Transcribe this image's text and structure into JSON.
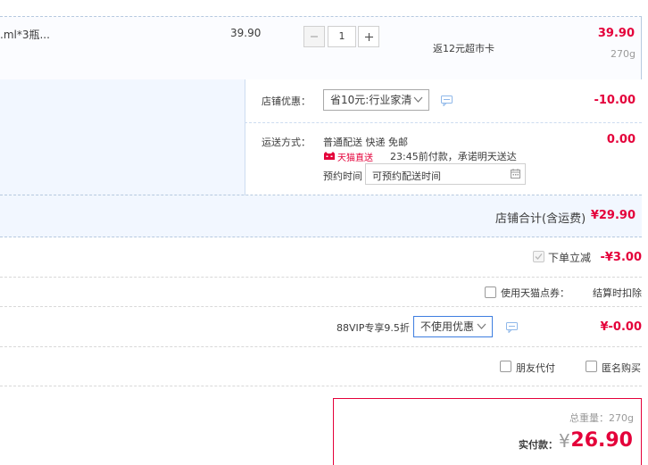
{
  "product": {
    "name_fragment": ".ml*3瓶...",
    "unit_price": "39.90",
    "quantity": "1",
    "minus_label": "−",
    "plus_label": "+",
    "promo": "返12元超市卡",
    "total": "39.90",
    "weight": "270g"
  },
  "shop": {
    "discount_label": "店铺优惠：",
    "discount_select": "省10元:行业家清",
    "discount_amount": "-10.00",
    "shipping_label": "运送方式：",
    "shipping_method": "普通配送 快递 免邮",
    "tmall_badge": "天猫直送",
    "delivery_note": "23:45前付款，承诺明天送达",
    "reserve_label": "预约时间",
    "reserve_placeholder": "可预约配送时间",
    "shipping_amount": "0.00",
    "subtotal_label": "店铺合计(含运费)",
    "subtotal_amount": "¥29.90"
  },
  "order": {
    "instant_label": "下单立减",
    "instant_amount": "-¥3.00",
    "points_label": "使用天猫点券：",
    "points_note": "结算时扣除",
    "vip_label": "88VIP专享9.5折",
    "vip_select": "不使用优惠",
    "vip_amount": "¥-0.00",
    "friend_pay_label": "朋友代付",
    "anonymous_label": "匿名购买"
  },
  "summary": {
    "weight_label": "总重量：270g",
    "paid_label": "实付款：",
    "currency": "¥",
    "paid_amount": "26.90"
  },
  "colors": {
    "accent_red": "#e4003a",
    "select_blue": "#3e7ee0",
    "shop_bg": "#f2f7ff",
    "chat_icon_blue": "#8fb8ea"
  },
  "icons": [
    "minus-icon",
    "plus-icon",
    "chevron-down-icon",
    "chat-bubble-icon",
    "tmall-cat-icon",
    "calendar-icon",
    "checkbox-icon"
  ]
}
